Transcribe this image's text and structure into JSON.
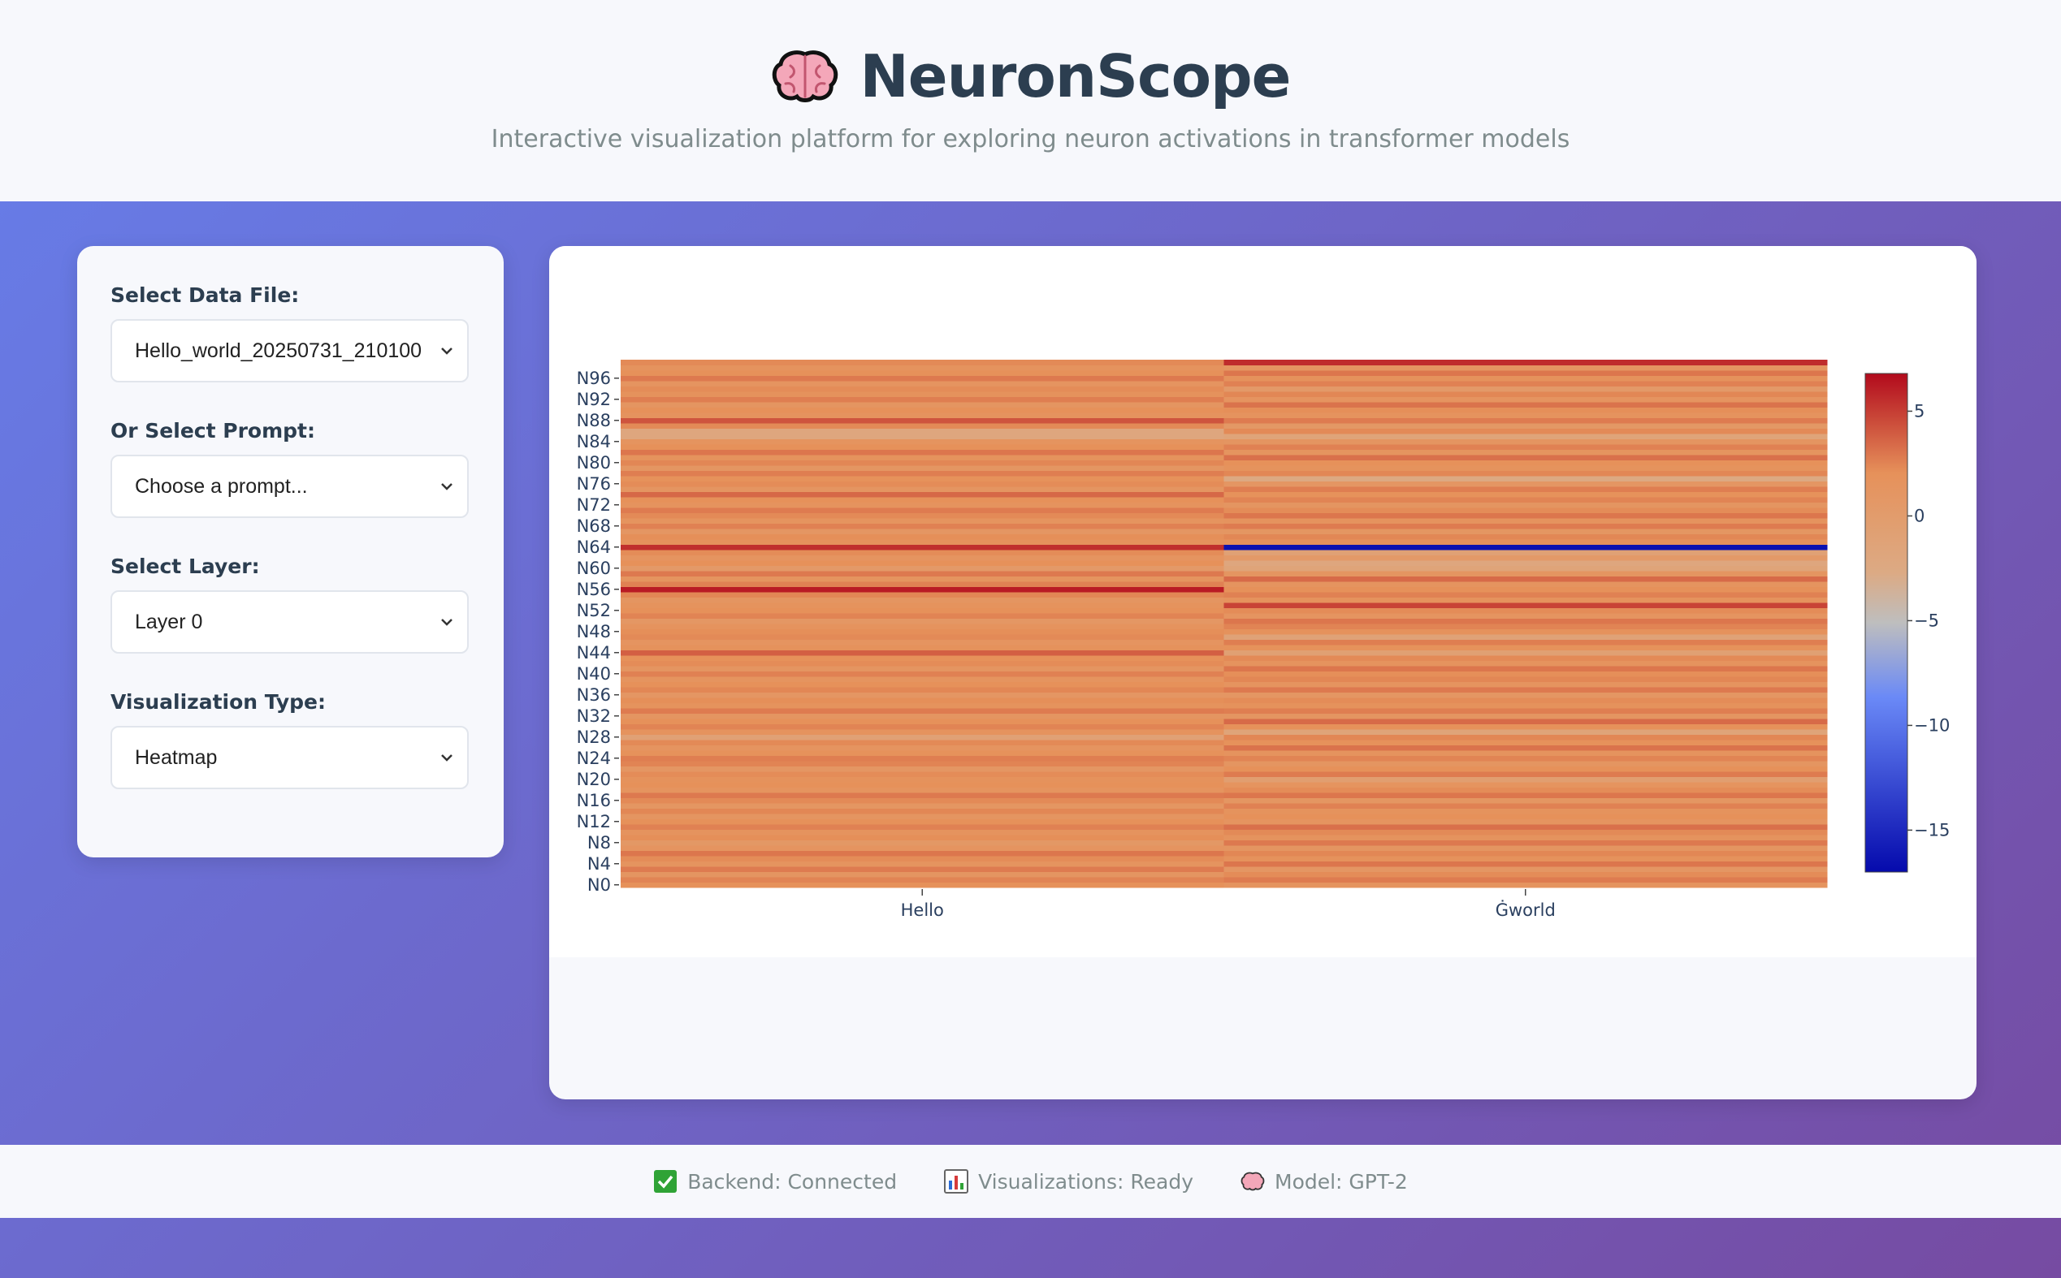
{
  "header": {
    "title": "NeuronScope",
    "subtitle": "Interactive visualization platform for exploring neuron activations in transformer models"
  },
  "sidebar": {
    "data_file_label": "Select Data File:",
    "data_file_value": "Hello_world_20250731_210100",
    "prompt_label": "Or Select Prompt:",
    "prompt_value": "Choose a prompt...",
    "layer_label": "Select Layer:",
    "layer_value": "Layer 0",
    "viz_type_label": "Visualization Type:",
    "viz_type_value": "Heatmap"
  },
  "footer": {
    "backend": "Backend: Connected",
    "visualizations": "Visualizations: Ready",
    "model": "Model: GPT-2"
  },
  "colors": {
    "gradient_start": "#667eea",
    "gradient_end": "#764ba2",
    "title": "#2c3e50",
    "subtitle": "#7f8c8d"
  },
  "chart_data": {
    "type": "heatmap",
    "x": [
      "Hello",
      "Ġworld"
    ],
    "y_tick_labels": [
      "N0",
      "N4",
      "N8",
      "N12",
      "N16",
      "N20",
      "N24",
      "N28",
      "N32",
      "N36",
      "N40",
      "N44",
      "N48",
      "N52",
      "N56",
      "N60",
      "N64",
      "N68",
      "N72",
      "N76",
      "N80",
      "N84",
      "N88",
      "N92",
      "N96"
    ],
    "colorscale": "RdBu reversed",
    "zlim": [
      -17,
      6.8
    ],
    "colorbar_ticks": [
      5,
      0,
      -5,
      -10,
      -15
    ],
    "series": [
      {
        "token": "Hello",
        "values": [
          2.0,
          2.5,
          1.2,
          2.8,
          1.5,
          2.2,
          3.0,
          1.4,
          0.8,
          2.1,
          1.6,
          2.6,
          2.0,
          1.3,
          2.4,
          1.1,
          2.3,
          2.9,
          1.5,
          2.0,
          1.8,
          2.2,
          1.0,
          2.5,
          2.7,
          1.9,
          1.4,
          2.3,
          -1.0,
          1.6,
          2.5,
          2.0,
          1.2,
          2.8,
          1.7,
          2.1,
          1.0,
          2.4,
          2.0,
          1.5,
          2.6,
          1.3,
          2.2,
          2.0,
          3.8,
          1.8,
          1.4,
          2.3,
          2.1,
          1.6,
          0.9,
          2.5,
          2.0,
          1.7,
          1.2,
          2.4,
          6.2,
          2.6,
          1.5,
          2.9,
          0.5,
          2.0,
          1.4,
          2.2,
          5.5,
          1.8,
          2.1,
          1.0,
          2.6,
          1.5,
          2.3,
          2.8,
          1.6,
          2.0,
          3.5,
          1.3,
          2.2,
          1.9,
          2.7,
          1.1,
          2.4,
          1.7,
          3.0,
          2.0,
          1.5,
          -2.0,
          -2.0,
          2.3,
          4.2,
          1.6,
          2.0,
          1.2,
          2.7,
          1.8,
          2.2,
          1.4,
          2.9,
          2.0,
          1.6,
          2.3
        ]
      },
      {
        "token": "Ġworld",
        "values": [
          1.5,
          2.8,
          2.2,
          1.0,
          3.0,
          1.8,
          2.4,
          1.2,
          2.9,
          1.6,
          2.3,
          3.2,
          1.4,
          2.0,
          1.7,
          2.6,
          1.1,
          3.0,
          2.2,
          1.5,
          -0.5,
          2.8,
          2.0,
          1.3,
          2.5,
          1.6,
          3.1,
          1.9,
          2.4,
          -1.5,
          2.0,
          3.4,
          1.2,
          2.7,
          1.8,
          2.2,
          1.0,
          2.9,
          1.5,
          2.4,
          2.1,
          3.0,
          1.6,
          2.3,
          -0.8,
          1.9,
          2.7,
          -1.2,
          1.8,
          2.5,
          3.0,
          1.4,
          2.2,
          4.8,
          1.7,
          2.6,
          2.0,
          1.5,
          3.4,
          1.2,
          -1.5,
          -2.0,
          0.5,
          -1.0,
          -16.5,
          1.8,
          2.4,
          1.1,
          2.8,
          1.6,
          3.0,
          2.2,
          1.3,
          2.5,
          1.9,
          2.7,
          1.0,
          -2.5,
          2.4,
          1.7,
          2.0,
          3.2,
          1.5,
          2.6,
          1.2,
          -1.5,
          2.3,
          0.8,
          2.8,
          1.6,
          2.1,
          3.1,
          1.4,
          2.4,
          0.5,
          2.6,
          1.8,
          3.0,
          1.2,
          5.6
        ]
      }
    ]
  }
}
